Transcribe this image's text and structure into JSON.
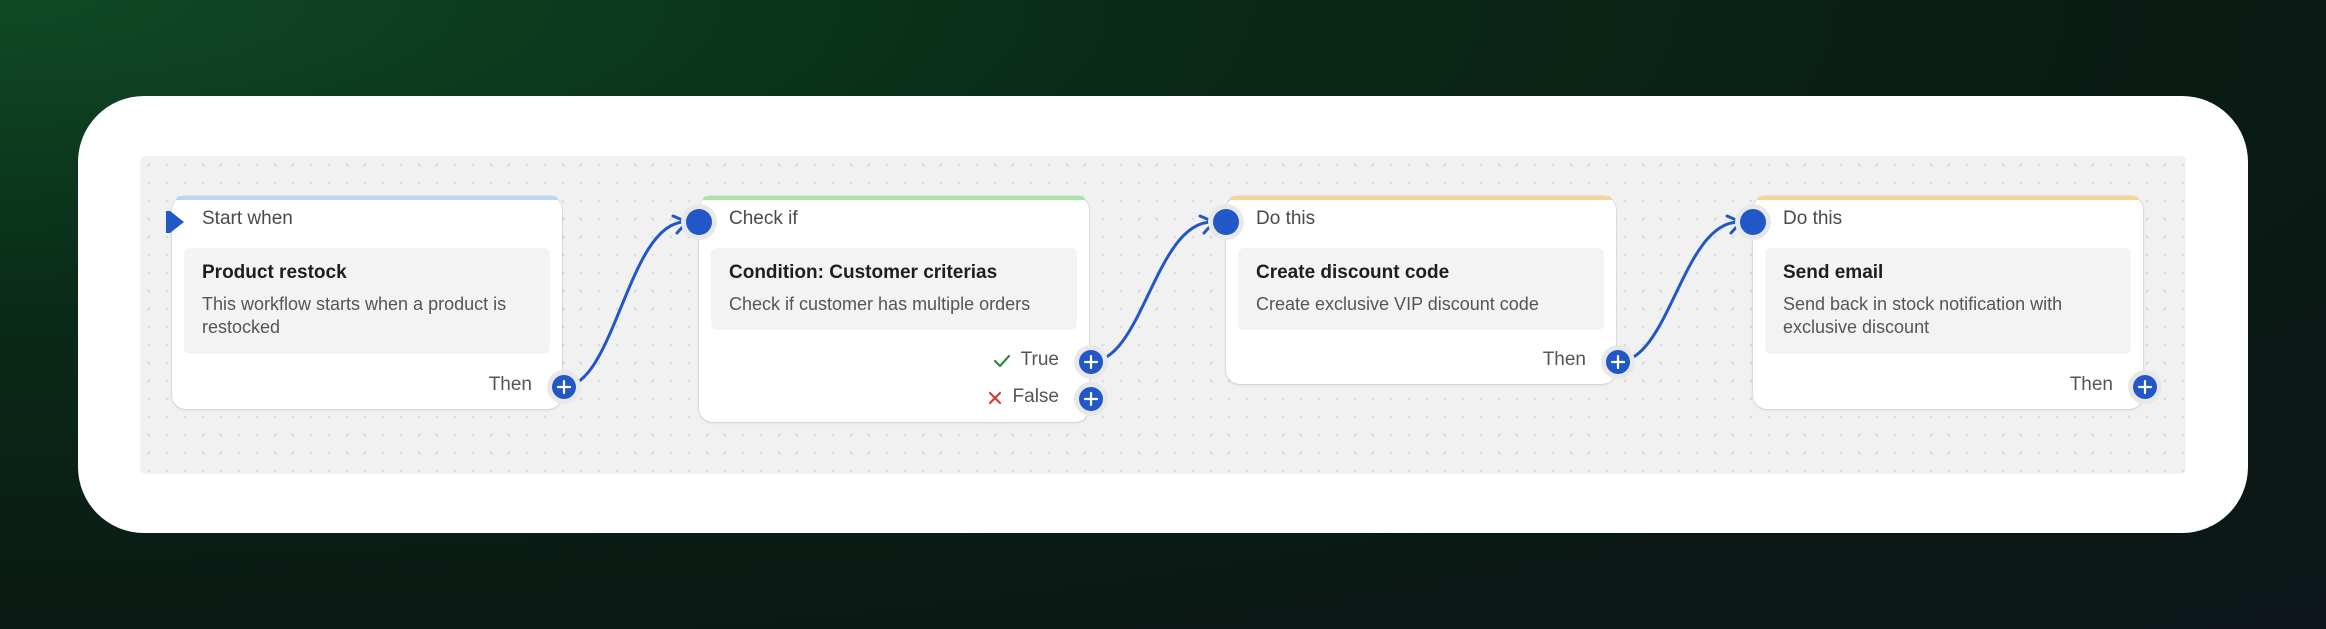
{
  "colors": {
    "trigger": "#bcd6f5",
    "condition": "#a8e6a8",
    "action": "#f8d39a",
    "port": "#2157c7",
    "true": "#2e8b3e",
    "false": "#d43c3c"
  },
  "nodes": [
    {
      "kind": "Start when",
      "title": "Product restock",
      "desc": "This workflow starts when a product is restocked",
      "then": "Then"
    },
    {
      "kind": "Check if",
      "title": "Condition: Customer criterias",
      "desc": "Check if customer has multiple orders",
      "true_label": "True",
      "false_label": "False"
    },
    {
      "kind": "Do this",
      "title": "Create discount code",
      "desc": "Create exclusive VIP discount code",
      "then": "Then"
    },
    {
      "kind": "Do this",
      "title": "Send email",
      "desc": "Send back in stock notification with exclusive discount",
      "then": "Then"
    }
  ],
  "icons": {
    "trigger": "play-flag-icon",
    "add": "plus-icon",
    "true": "checkmark-icon",
    "false": "x-mark-icon"
  }
}
